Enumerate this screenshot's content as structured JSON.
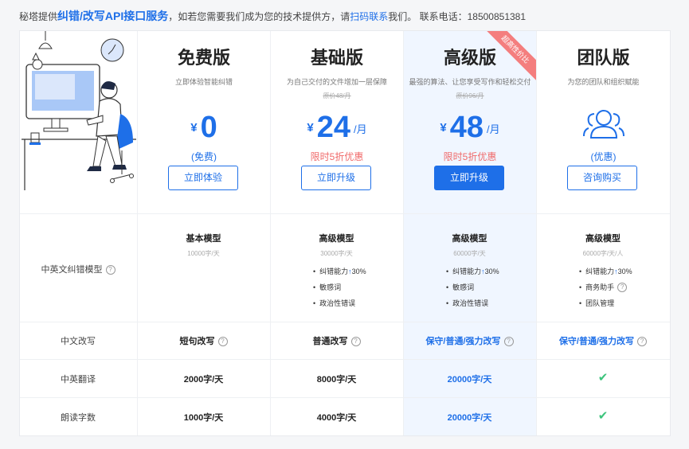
{
  "notice": {
    "prefix": "秘塔提供",
    "highlight": "纠错/改写API接口服务",
    "mid": "，如若您需要我们成为您的技术提供方，请",
    "link": "扫码联系",
    "suffix": "我们。 联系电话：18500851381"
  },
  "colors": {
    "accent": "#1e6fe8",
    "red": "#f06a6a",
    "check": "#3cc47c"
  },
  "plans": [
    {
      "title": "免费版",
      "desc": "立即体验智能纠错",
      "orig": "",
      "currency": "¥",
      "price": "0",
      "unit": "",
      "note": "(免费)",
      "button": "立即体验"
    },
    {
      "title": "基础版",
      "desc": "为自己交付的文件增加一层保障",
      "orig": "原价48/月",
      "currency": "¥",
      "price": "24",
      "unit": "/月",
      "note": "限时5折优惠",
      "button": "立即升级"
    },
    {
      "title": "高级版",
      "desc": "最强的算法、让您享受写作和轻松交付",
      "orig": "原价96/月",
      "currency": "¥",
      "price": "48",
      "unit": "/月",
      "note": "限时5折优惠",
      "button": "立即升级",
      "ribbon": "超高性价比"
    },
    {
      "title": "团队版",
      "desc": "为您的团队和组织赋能",
      "icon": "team-icon",
      "note": "(优惠)",
      "button": "咨询购买"
    }
  ],
  "rows": {
    "model": {
      "label": "中英文纠错模型",
      "cells": [
        {
          "title": "基本模型",
          "sub": "10000字/天",
          "features": []
        },
        {
          "title": "高级模型",
          "sub": "30000字/天",
          "features": [
            "纠错能力",
            "敏感词",
            "政治性错误"
          ],
          "boost": "30%"
        },
        {
          "title": "高级模型",
          "sub": "60000字/天",
          "features": [
            "纠错能力",
            "敏感词",
            "政治性错误"
          ],
          "boost": "30%"
        },
        {
          "title": "高级模型",
          "sub": "60000字/天/人",
          "features": [
            "纠错能力",
            "商务助手",
            "团队管理"
          ],
          "boost": "30%"
        }
      ]
    },
    "rewrite": {
      "label": "中文改写",
      "cells": [
        "短句改写",
        "普通改写",
        "保守/普通/强力改写",
        "保守/普通/强力改写"
      ]
    },
    "translate": {
      "label": "中英翻译",
      "cells": [
        "2000字/天",
        "8000字/天",
        "20000字/天",
        "check-icon"
      ]
    },
    "read": {
      "label": "朗读字数",
      "cells": [
        "1000字/天",
        "4000字/天",
        "20000字/天",
        "check-icon"
      ]
    }
  }
}
